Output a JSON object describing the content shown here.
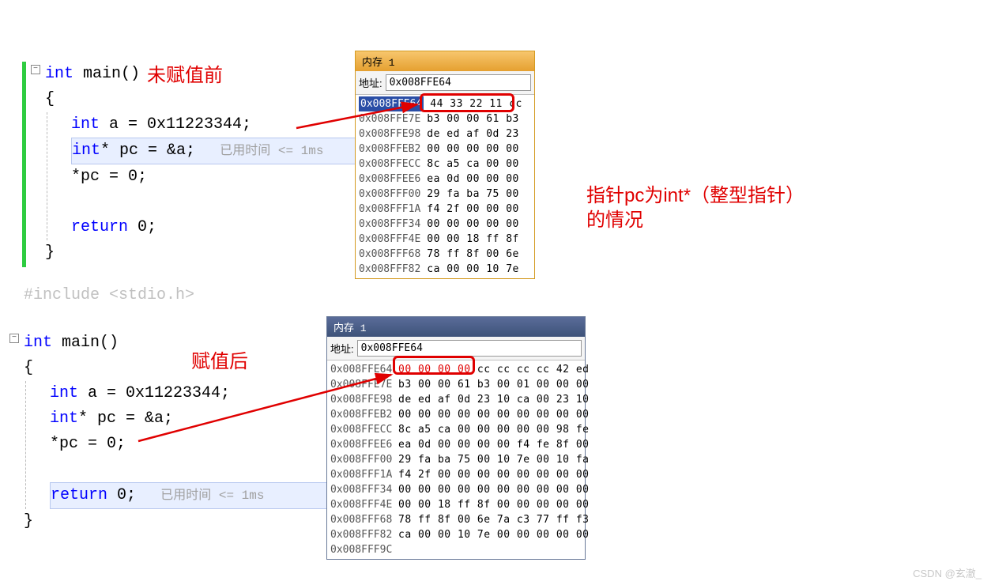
{
  "annotations": {
    "before": "未赋值前",
    "after": "赋值后",
    "explanation_line1": "指针pc为int*（整型指针）",
    "explanation_line2": "的情况",
    "timing": "已用时间 <= 1ms"
  },
  "code1": {
    "fn_decl_pre": "int",
    "fn_decl_name": " main()",
    "open_brace": "{",
    "line1_pre": "int",
    "line1_rest": " a = 0x11223344;",
    "line2_pre": "int",
    "line2_mid": "* pc = &a;",
    "line3": "*pc = 0;",
    "line_ret_pre": "return",
    "line_ret_rest": " 0;",
    "close_brace": "}"
  },
  "code2": {
    "include_dim": "#include <stdio.h>",
    "fn_decl_pre": "int",
    "fn_decl_name": " main()",
    "open_brace": "{",
    "line1_pre": "int",
    "line1_rest": " a = 0x11223344;",
    "line2_pre": "int",
    "line2_mid": "* pc = &a;",
    "line3": "*pc = 0;",
    "line_ret_pre": "return",
    "line_ret_rest": " 0;",
    "close_brace": "}"
  },
  "memory1": {
    "title": "内存 1",
    "addr_label": "地址:",
    "addr_value": "0x008FFE64",
    "rows": [
      {
        "addr": "0x008FFE64",
        "bytes": "44 33 22 11",
        "trail": " cc"
      },
      {
        "addr": "0x008FFE7E",
        "bytes": "b3 00 00 61 b3"
      },
      {
        "addr": "0x008FFE98",
        "bytes": "de ed af 0d 23"
      },
      {
        "addr": "0x008FFEB2",
        "bytes": "00 00 00 00 00"
      },
      {
        "addr": "0x008FFECC",
        "bytes": "8c a5 ca 00 00"
      },
      {
        "addr": "0x008FFEE6",
        "bytes": "ea 0d 00 00 00"
      },
      {
        "addr": "0x008FFF00",
        "bytes": "29 fa ba 75 00"
      },
      {
        "addr": "0x008FFF1A",
        "bytes": "f4 2f 00 00 00"
      },
      {
        "addr": "0x008FFF34",
        "bytes": "00 00 00 00 00"
      },
      {
        "addr": "0x008FFF4E",
        "bytes": "00 00 18 ff 8f"
      },
      {
        "addr": "0x008FFF68",
        "bytes": "78 ff 8f 00 6e"
      },
      {
        "addr": "0x008FFF82",
        "bytes": "ca 00 00 10 7e"
      }
    ]
  },
  "memory2": {
    "title": "内存 1",
    "addr_label": "地址:",
    "addr_value": "0x008FFE64",
    "rows": [
      {
        "addr": "0x008FFE64",
        "bytes_hl": "00 00 00 00",
        "trail": " cc cc cc cc 42 ed"
      },
      {
        "addr": "0x008FFE7E",
        "bytes": "b3 00 00 61 b3 00 01 00 00 00"
      },
      {
        "addr": "0x008FFE98",
        "bytes": "de ed af 0d 23 10 ca 00 23 10"
      },
      {
        "addr": "0x008FFEB2",
        "bytes": "00 00 00 00 00 00 00 00 00 00"
      },
      {
        "addr": "0x008FFECC",
        "bytes": "8c a5 ca 00 00 00 00 00 98 fe"
      },
      {
        "addr": "0x008FFEE6",
        "bytes": "ea 0d 00 00 00 00 f4 fe 8f 00"
      },
      {
        "addr": "0x008FFF00",
        "bytes": "29 fa ba 75 00 10 7e 00 10 fa"
      },
      {
        "addr": "0x008FFF1A",
        "bytes": "f4 2f 00 00 00 00 00 00 00 00"
      },
      {
        "addr": "0x008FFF34",
        "bytes": "00 00 00 00 00 00 00 00 00 00"
      },
      {
        "addr": "0x008FFF4E",
        "bytes": "00 00 18 ff 8f 00 00 00 00 00"
      },
      {
        "addr": "0x008FFF68",
        "bytes": "78 ff 8f 00 6e 7a c3 77 ff f3"
      },
      {
        "addr": "0x008FFF82",
        "bytes": "ca 00 00 10 7e 00 00 00 00 00"
      },
      {
        "addr": "0x008FFF9C",
        "bytes": ""
      }
    ]
  },
  "watermark": "CSDN @玄澈_"
}
